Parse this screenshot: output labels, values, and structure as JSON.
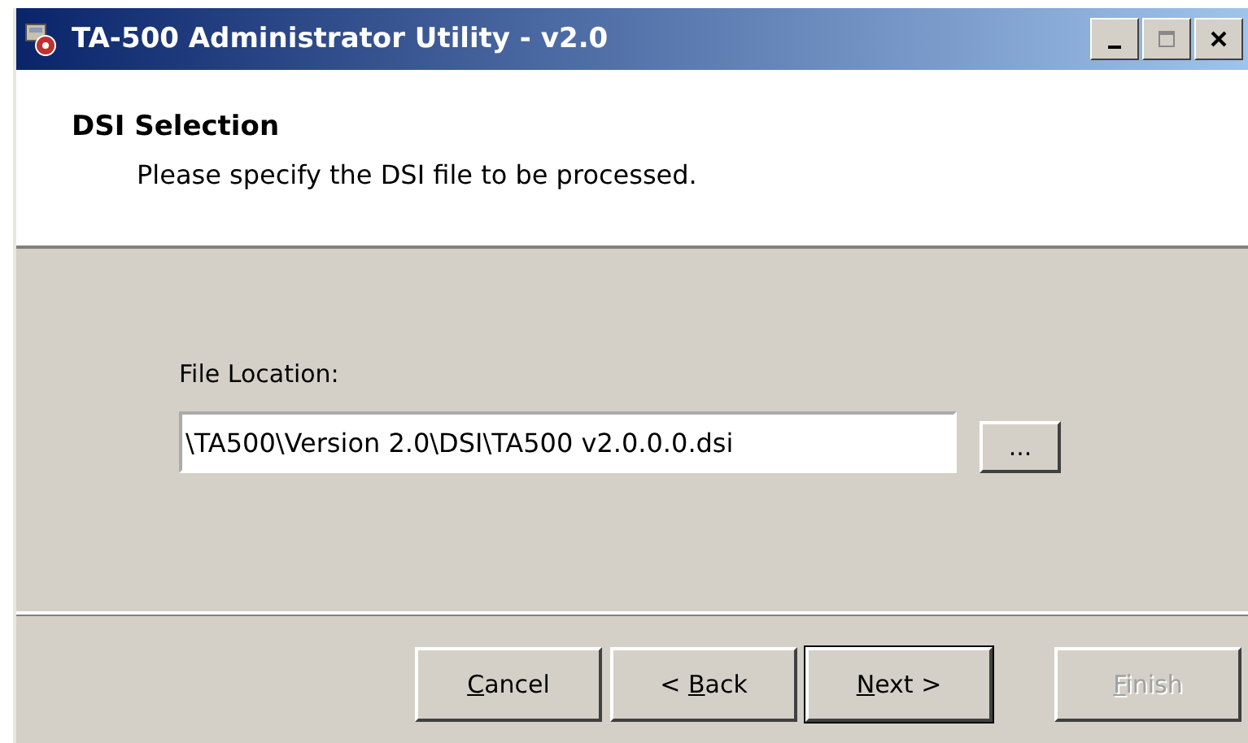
{
  "window": {
    "title": "TA-500 Administrator Utility - v2.0"
  },
  "header": {
    "title": "DSI Selection",
    "subtitle": "Please specify the DSI file to be processed."
  },
  "file_location": {
    "label": "File Location:",
    "value": "\\TA500\\Version 2.0\\DSI\\TA500 v2.0.0.0.dsi",
    "browse": "..."
  },
  "buttons": [
    {
      "access_key": "C",
      "label_rest": "ancel",
      "disabled": false,
      "default": false
    },
    {
      "label_start": "< ",
      "access_key": "B",
      "label_rest": "ack",
      "disabled": false,
      "default": false
    },
    {
      "access_key": "N",
      "label_rest": "ext >",
      "disabled": false,
      "default": true
    },
    {
      "access_key": "F",
      "label_rest": "inish",
      "disabled": true,
      "default": false
    }
  ]
}
